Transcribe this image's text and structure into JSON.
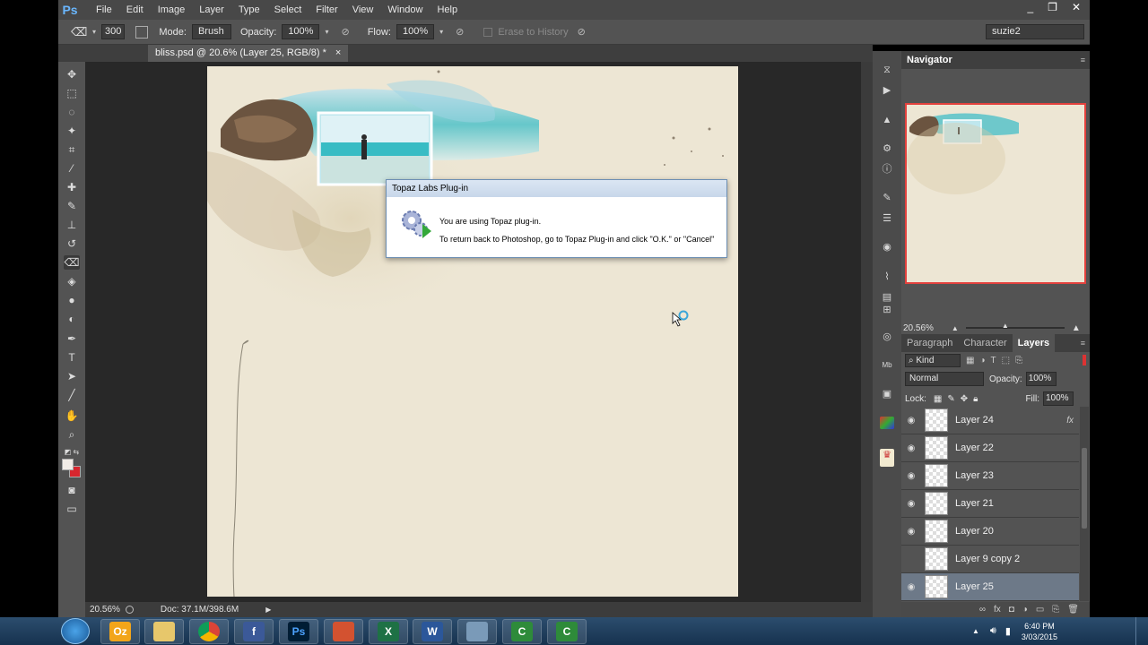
{
  "app": {
    "logo": "Ps",
    "window_controls": [
      "_",
      "❐",
      "✕"
    ]
  },
  "menu": [
    "File",
    "Edit",
    "Image",
    "Layer",
    "Type",
    "Select",
    "Filter",
    "View",
    "Window",
    "Help"
  ],
  "options": {
    "brush_size": "300",
    "mode_label": "Mode:",
    "mode_value": "Brush",
    "opacity_label": "Opacity:",
    "opacity_value": "100%",
    "flow_label": "Flow:",
    "flow_value": "100%",
    "erase_history": "Erase to History",
    "workspace": "suzie2"
  },
  "document": {
    "tab_title": "bliss.psd @ 20.6% (Layer 25, RGB/8) *",
    "close": "×"
  },
  "status": {
    "zoom": "20.56%",
    "doc": "Doc: 37.1M/398.6M"
  },
  "dialog": {
    "title": "Topaz Labs Plug-in",
    "line1": "You are using Topaz plug-in.",
    "line2": "To return back to Photoshop, go to Topaz Plug-in and click \"O.K.\" or \"Cancel\""
  },
  "navigator": {
    "title": "Navigator",
    "zoom": "20.56%"
  },
  "layers_panel": {
    "tabs": [
      "Paragraph",
      "Character",
      "Layers"
    ],
    "active_tab": "Layers",
    "filter_kind": "Kind",
    "blend_mode": "Normal",
    "opacity_label": "Opacity:",
    "opacity_value": "100%",
    "lock_label": "Lock:",
    "fill_label": "Fill:",
    "fill_value": "100%",
    "layers": [
      {
        "name": "Layer 24",
        "visible": true,
        "fx": "fx",
        "selected": false
      },
      {
        "name": "Layer 22",
        "visible": true,
        "fx": "",
        "selected": false
      },
      {
        "name": "Layer 23",
        "visible": true,
        "fx": "",
        "selected": false
      },
      {
        "name": "Layer 21",
        "visible": true,
        "fx": "",
        "selected": false
      },
      {
        "name": "Layer 20",
        "visible": true,
        "fx": "",
        "selected": false
      },
      {
        "name": "Layer 9 copy 2",
        "visible": false,
        "fx": "",
        "selected": false
      },
      {
        "name": "Layer 25",
        "visible": true,
        "fx": "",
        "selected": true
      }
    ]
  },
  "taskbar": {
    "apps": [
      "outlook",
      "explorer",
      "chrome",
      "facebook",
      "photoshop",
      "powerpoint",
      "excel",
      "word",
      "screen",
      "camtasia",
      "camtasia-2"
    ],
    "app_labels": [
      "Oz",
      "",
      "",
      "f",
      "Ps",
      "",
      "X",
      "W",
      "",
      "C",
      "C"
    ],
    "time": "6:40 PM",
    "date": "3/03/2015"
  },
  "colors": {
    "accent": "#6ab7ff",
    "selected_layer": "#6d7988",
    "foreground": "#f2ece6",
    "background": "#d7262e"
  }
}
